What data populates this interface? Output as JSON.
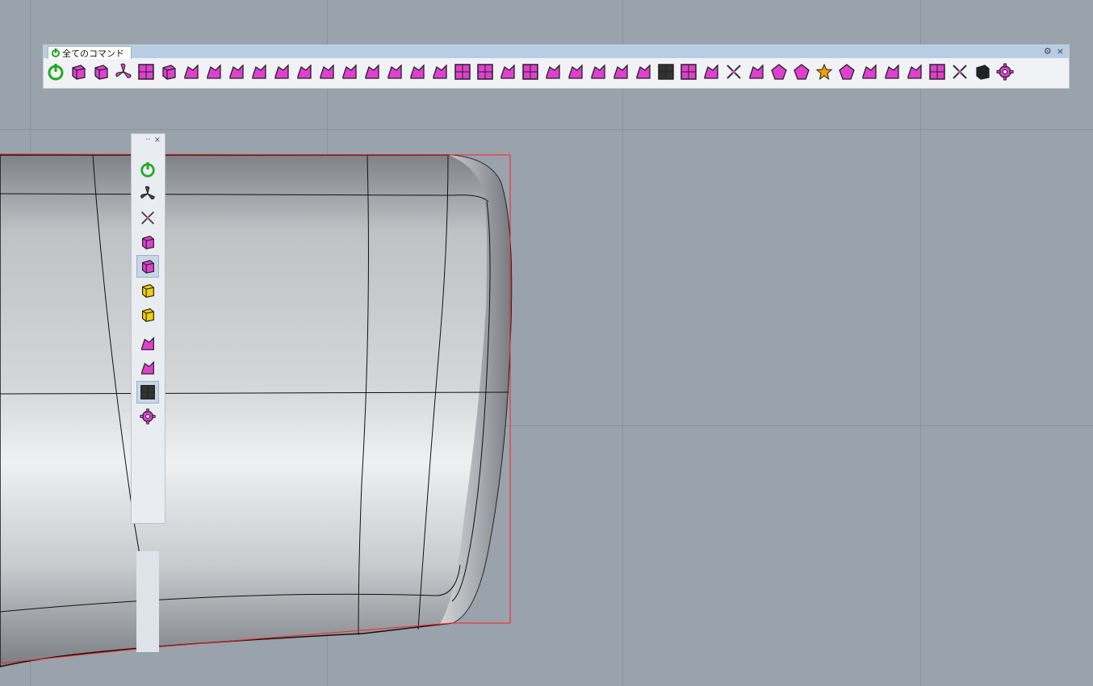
{
  "toolbar": {
    "tab_label": "全てのコマンド",
    "gear_glyph": "⚙",
    "close_glyph": "×",
    "icons": [
      {
        "name": "power-icon",
        "color": "#22aa22"
      },
      {
        "name": "box-solid-icon",
        "color": "#e040d0"
      },
      {
        "name": "cube-explode-icon",
        "color": "#e040d0"
      },
      {
        "name": "propeller-icon",
        "color": "#e040d0"
      },
      {
        "name": "table-mesh-icon",
        "color": "#e040d0"
      },
      {
        "name": "box-wireframe-icon",
        "color": "#e040d0"
      },
      {
        "name": "arrow-curve-icon",
        "color": "#e040d0"
      },
      {
        "name": "branch-icon",
        "color": "#e040d0"
      },
      {
        "name": "node-flow-icon",
        "color": "#e040d0"
      },
      {
        "name": "shear-icon",
        "color": "#e040d0"
      },
      {
        "name": "arch-icon",
        "color": "#e040d0"
      },
      {
        "name": "bend-icon",
        "color": "#e040d0"
      },
      {
        "name": "fold-icon",
        "color": "#e040d0"
      },
      {
        "name": "book-icon",
        "color": "#e040d0"
      },
      {
        "name": "panel-icon",
        "color": "#e040d0"
      },
      {
        "name": "tag-icon",
        "color": "#e040d0"
      },
      {
        "name": "ribbon-icon",
        "color": "#e040d0"
      },
      {
        "name": "bridge-icon",
        "color": "#e040d0"
      },
      {
        "name": "check-frame-icon",
        "color": "#e040d0"
      },
      {
        "name": "grid-four-icon",
        "color": "#e040d0"
      },
      {
        "name": "stack-icon",
        "color": "#e040d0"
      },
      {
        "name": "grid-delete-icon",
        "color": "#e040d0"
      },
      {
        "name": "split-a-icon",
        "color": "#e040d0"
      },
      {
        "name": "split-b-icon",
        "color": "#e040d0"
      },
      {
        "name": "merge-icon",
        "color": "#e040d0"
      },
      {
        "name": "sweep-icon",
        "color": "#e040d0"
      },
      {
        "name": "scan-icon",
        "color": "#e040d0"
      },
      {
        "name": "dots-grid-icon",
        "color": "#333333"
      },
      {
        "name": "frame-curve-icon",
        "color": "#e040d0"
      },
      {
        "name": "hand-icon",
        "color": "#e040d0"
      },
      {
        "name": "dashed-arrow-icon",
        "color": "#333333"
      },
      {
        "name": "branch-y-icon",
        "color": "#e040d0"
      },
      {
        "name": "diamond-icon",
        "color": "#e040d0"
      },
      {
        "name": "target-icon",
        "color": "#e040d0"
      },
      {
        "name": "star-rotate-icon",
        "color": "#f0a000"
      },
      {
        "name": "pentagon-icon",
        "color": "#e040d0"
      },
      {
        "name": "comb-icon",
        "color": "#e040d0"
      },
      {
        "name": "layer-icon",
        "color": "#e040d0"
      },
      {
        "name": "sheet-icon",
        "color": "#e040d0"
      },
      {
        "name": "mesh-sheet-icon",
        "color": "#e040d0"
      },
      {
        "name": "cross-icon",
        "color": "#333333"
      },
      {
        "name": "dark-box-icon",
        "color": "#222222"
      },
      {
        "name": "gear-puzzle-icon",
        "color": "#e040d0"
      }
    ]
  },
  "vtoolbar": {
    "handle_glyph": "··",
    "close_glyph": "×",
    "icons": [
      {
        "name": "power-icon",
        "color": "#22aa22"
      },
      {
        "name": "propeller-icon",
        "color": "#444444"
      },
      {
        "name": "axes-icon",
        "color": "#444444"
      },
      {
        "name": "cube-point-icon",
        "color": "#e040d0"
      },
      {
        "name": "cube-select-icon",
        "color": "#e040d0",
        "active": true
      },
      {
        "name": "cube-yellow-icon",
        "color": "#f0d000"
      },
      {
        "name": "cube-yellow-outline-icon",
        "color": "#f0d000"
      },
      {
        "name": "paint-bucket-icon",
        "color": "#e040d0",
        "sep_before": true
      },
      {
        "name": "erase-icon",
        "color": "#e040d0"
      },
      {
        "name": "frame-h-icon",
        "color": "#333333",
        "active": true
      },
      {
        "name": "gear-puzzle-icon",
        "color": "#e040d0"
      }
    ]
  },
  "viewport": {
    "surface_color": "#cfd3d7",
    "outline_color": "#ff2020"
  }
}
